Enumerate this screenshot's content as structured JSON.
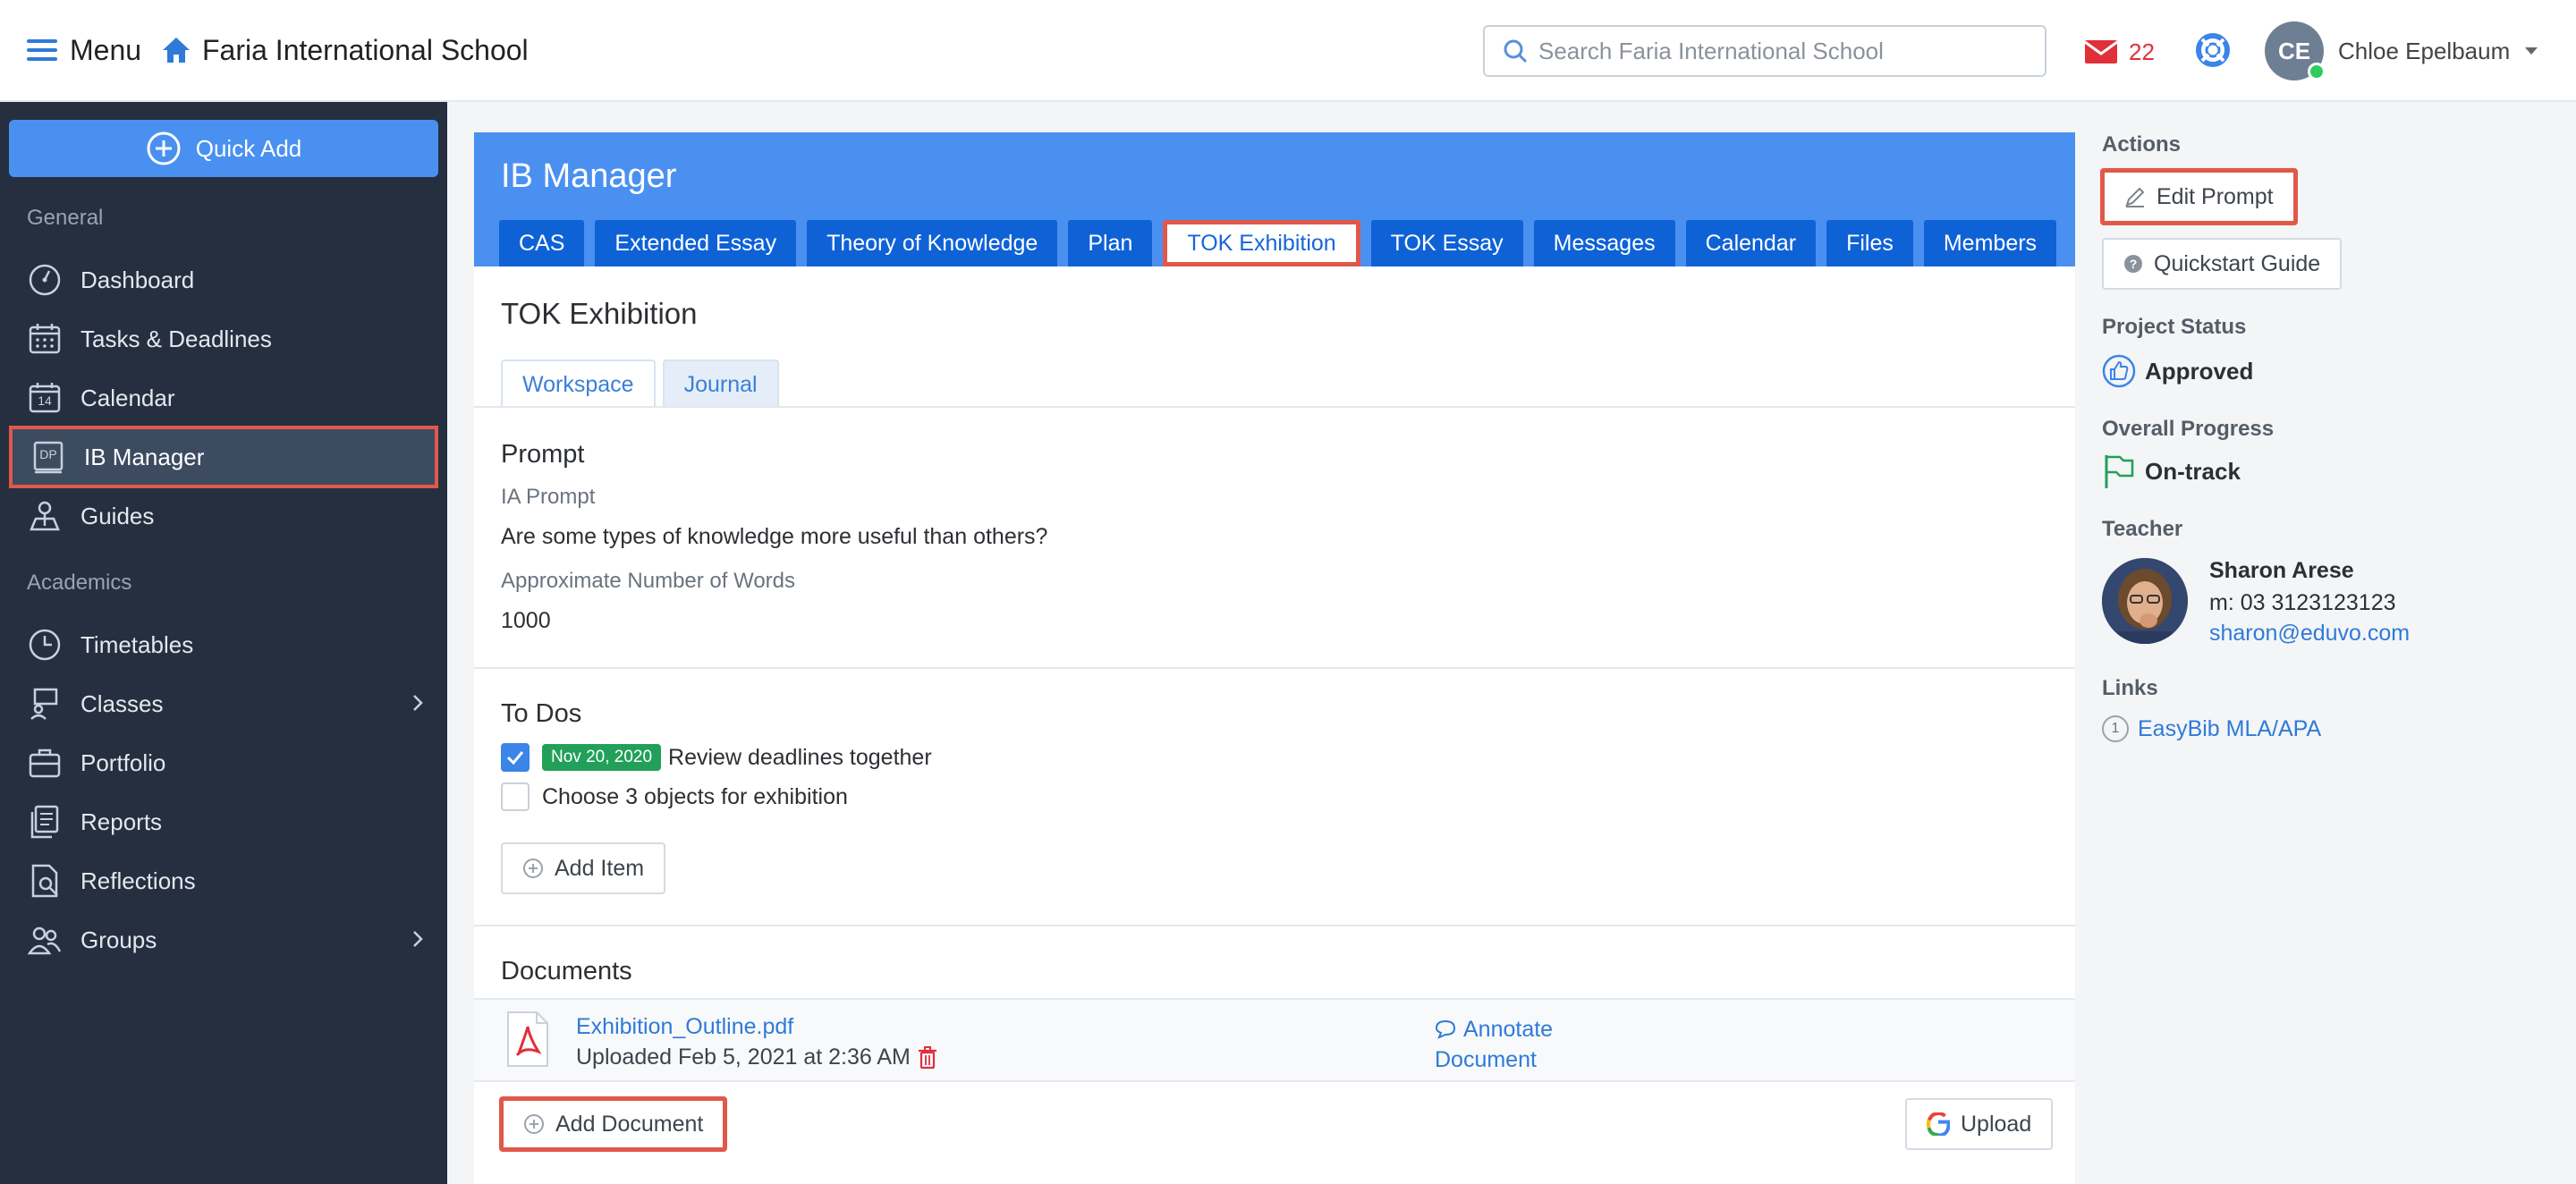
{
  "topbar": {
    "menu_label": "Menu",
    "school_name": "Faria International School",
    "search_placeholder": "Search Faria International School",
    "mail_count": "22",
    "user_initials": "CE",
    "user_name": "Chloe Epelbaum"
  },
  "sidebar": {
    "quick_add": "Quick Add",
    "section_general": "General",
    "section_academics": "Academics",
    "items": [
      {
        "label": "Dashboard",
        "icon": "dashboard-icon"
      },
      {
        "label": "Tasks & Deadlines",
        "icon": "tasks-icon"
      },
      {
        "label": "Calendar",
        "icon": "calendar-icon",
        "icon_text": "14"
      },
      {
        "label": "IB Manager",
        "icon": "ib-manager-icon",
        "icon_text": "DP",
        "active": true
      },
      {
        "label": "Guides",
        "icon": "guides-icon"
      },
      {
        "label": "Timetables",
        "icon": "clock-icon"
      },
      {
        "label": "Classes",
        "icon": "classes-icon",
        "has_children": true
      },
      {
        "label": "Portfolio",
        "icon": "briefcase-icon"
      },
      {
        "label": "Reports",
        "icon": "reports-icon"
      },
      {
        "label": "Reflections",
        "icon": "reflections-icon"
      },
      {
        "label": "Groups",
        "icon": "groups-icon",
        "has_children": true
      }
    ]
  },
  "main": {
    "header_title": "IB Manager",
    "tabs": [
      "CAS",
      "Extended Essay",
      "Theory of Knowledge",
      "Plan",
      "TOK Exhibition",
      "TOK Essay",
      "Messages",
      "Calendar",
      "Files",
      "Members"
    ],
    "active_tab": "TOK Exhibition",
    "section_title": "TOK Exhibition",
    "subtabs": [
      "Workspace",
      "Journal"
    ],
    "active_subtab": "Workspace",
    "prompt": {
      "heading": "Prompt",
      "ia_label": "IA Prompt",
      "ia_value": "Are some types of knowledge more useful than others?",
      "words_label": "Approximate Number of Words",
      "words_value": "1000"
    },
    "todos": {
      "heading": "To Dos",
      "items": [
        {
          "checked": true,
          "date": "Nov 20, 2020",
          "text": "Review deadlines together"
        },
        {
          "checked": false,
          "text": "Choose 3 objects for exhibition"
        }
      ],
      "add_label": "Add Item"
    },
    "documents": {
      "heading": "Documents",
      "file_name": "Exhibition_Outline.pdf",
      "uploaded": "Uploaded Feb 5, 2021 at 2:36 AM",
      "annotate_line1": "Annotate",
      "annotate_line2": "Document",
      "add_label": "Add Document",
      "upload_label": "Upload"
    }
  },
  "right": {
    "actions_heading": "Actions",
    "edit_prompt": "Edit Prompt",
    "quickstart": "Quickstart Guide",
    "status_heading": "Project Status",
    "status_value": "Approved",
    "progress_heading": "Overall Progress",
    "progress_value": "On-track",
    "teacher_heading": "Teacher",
    "teacher_name": "Sharon Arese",
    "teacher_phone": "m: 03 3123123123",
    "teacher_email": "sharon@eduvo.com",
    "links_heading": "Links",
    "link_number": "1",
    "link_label": "EasyBib MLA/APA"
  },
  "colors": {
    "brand_blue": "#4a90f1",
    "tab_blue": "#0e62d6",
    "sidebar_bg": "#252f3f",
    "highlight_red": "#e0584a",
    "badge_green": "#22a05a"
  }
}
